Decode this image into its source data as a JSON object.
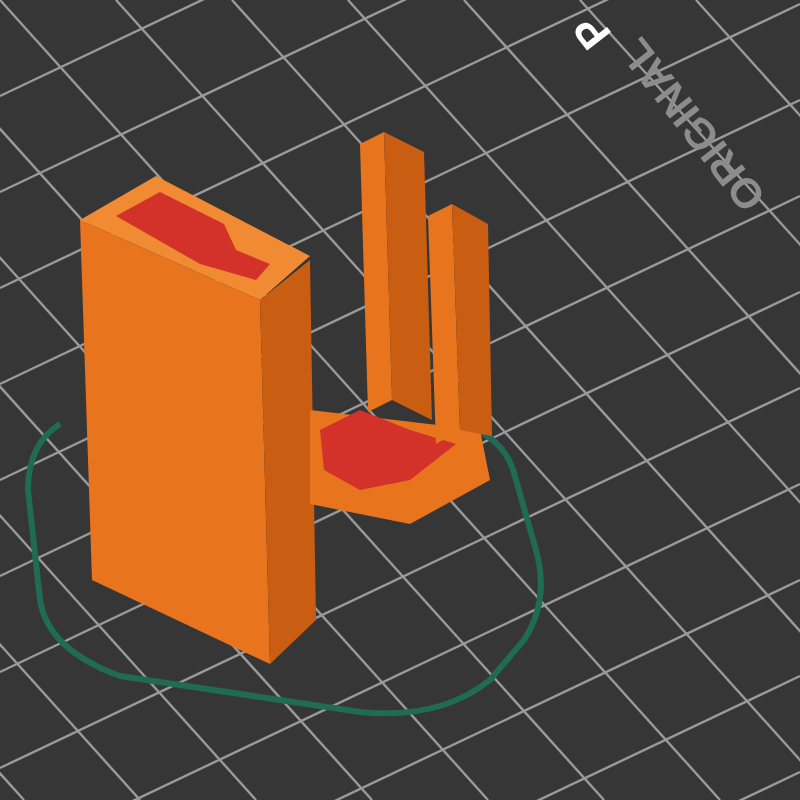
{
  "viewport": {
    "bed_labels": [
      {
        "kind": "logo",
        "text": "ORIGINAL"
      },
      {
        "kind": "logo-bold",
        "text": "P"
      }
    ]
  }
}
